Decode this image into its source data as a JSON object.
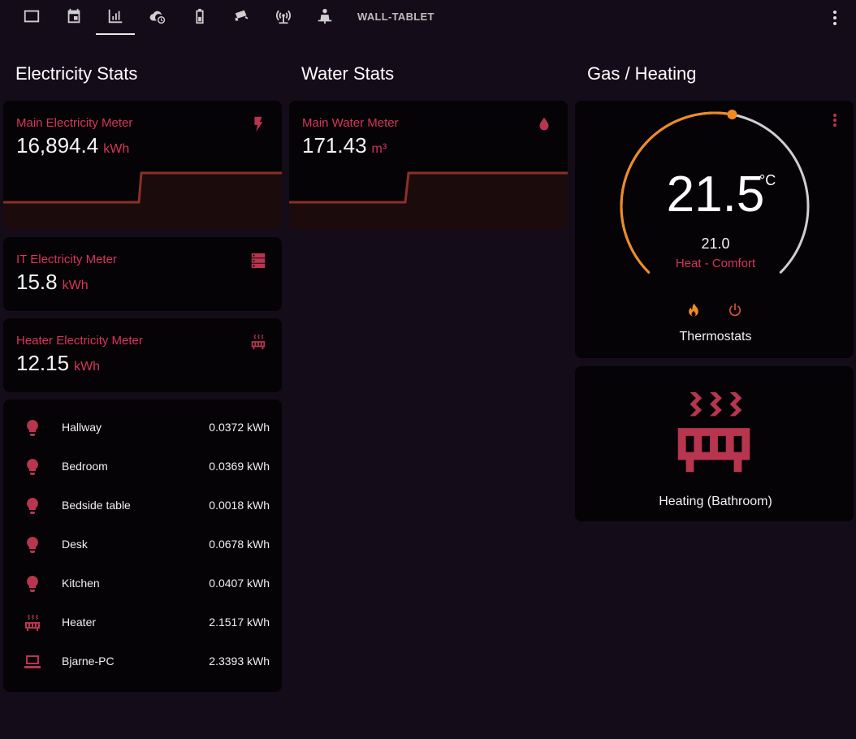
{
  "header": {
    "tabs": [
      {
        "icon": "tablet-icon"
      },
      {
        "icon": "calendar-icon"
      },
      {
        "icon": "chart-icon",
        "active": true
      },
      {
        "icon": "cloud-clock-icon"
      },
      {
        "icon": "battery-icon"
      },
      {
        "icon": "cctv-icon"
      },
      {
        "icon": "access-point-icon"
      },
      {
        "icon": "person-desk-icon"
      }
    ],
    "tab_label": "WALL-TABLET",
    "menu_icon": "dots-vertical-icon"
  },
  "columns": {
    "electricity": {
      "title": "Electricity Stats"
    },
    "water": {
      "title": "Water Stats"
    },
    "gas": {
      "title": "Gas / Heating"
    }
  },
  "cards": {
    "main_electricity": {
      "name": "Main Electricity Meter",
      "value": "16,894.4",
      "unit": "kWh",
      "icon": "flash-icon"
    },
    "it_electricity": {
      "name": "IT Electricity Meter",
      "value": "15.8",
      "unit": "kWh",
      "icon": "server-icon"
    },
    "heater_electricity": {
      "name": "Heater Electricity Meter",
      "value": "12.15",
      "unit": "kWh",
      "icon": "radiator-icon"
    },
    "main_water": {
      "name": "Main Water Meter",
      "value": "171.43",
      "unit": "m³",
      "icon": "water-drop-icon"
    }
  },
  "entities": [
    {
      "name": "Hallway",
      "value": "0.0372 kWh",
      "icon": "lightbulb-icon"
    },
    {
      "name": "Bedroom",
      "value": "0.0369 kWh",
      "icon": "lightbulb-icon"
    },
    {
      "name": "Bedside table",
      "value": "0.0018 kWh",
      "icon": "lightbulb-icon"
    },
    {
      "name": "Desk",
      "value": "0.0678 kWh",
      "icon": "lightbulb-icon"
    },
    {
      "name": "Kitchen",
      "value": "0.0407 kWh",
      "icon": "lightbulb-icon"
    },
    {
      "name": "Heater",
      "value": "2.1517 kWh",
      "icon": "radiator-icon"
    },
    {
      "name": "Bjarne-PC",
      "value": "2.3393 kWh",
      "icon": "laptop-icon"
    }
  ],
  "thermostat": {
    "current": "21.5",
    "unit": "°C",
    "target": "21.0",
    "mode": "Heat - Comfort",
    "name": "Thermostats",
    "level": 0.54
  },
  "heating": {
    "name": "Heating (Bathroom)",
    "icon": "radiator-icon"
  },
  "colors": {
    "background": "#150c1a",
    "card": "#050306",
    "accent": "#d6365a",
    "icon": "#b8354f",
    "heat": "#f08a24",
    "graph_line": "#8a3028",
    "graph_fill": "#1c0b0c"
  }
}
